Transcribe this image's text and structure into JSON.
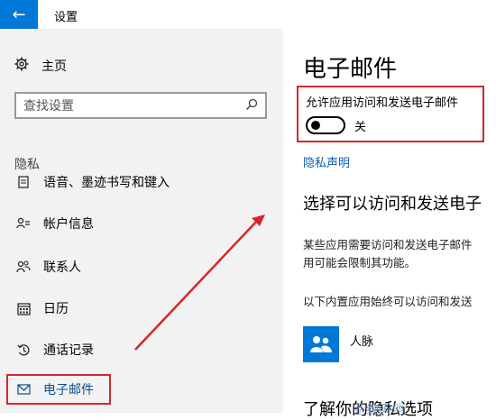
{
  "titlebar": {
    "title": "设置",
    "back_icon": "back-arrow-icon"
  },
  "sidebar": {
    "home_label": "主页",
    "search_placeholder": "查找设置",
    "section_header": "隐私",
    "items": [
      {
        "label": "语音、墨迹书写和键入",
        "icon": "pen-icon"
      },
      {
        "label": "帐户信息",
        "icon": "account-info-icon"
      },
      {
        "label": "联系人",
        "icon": "contacts-icon"
      },
      {
        "label": "日历",
        "icon": "calendar-icon"
      },
      {
        "label": "通话记录",
        "icon": "call-history-icon"
      },
      {
        "label": "电子邮件",
        "icon": "mail-icon",
        "selected": true
      }
    ]
  },
  "main": {
    "title": "电子邮件",
    "toggle": {
      "label": "允许应用访问和发送电子邮件",
      "state_text": "关",
      "on": false
    },
    "privacy_link": "隐私声明",
    "section_heading": "选择可以访问和发送电子",
    "description_line1": "某些应用需要访问和发送电子邮件",
    "description_line2": "用可能会限制其功能。",
    "builtin_note": "以下内置应用始终可以访问和发送",
    "apps": [
      {
        "name": "人脉",
        "icon": "people-app-icon"
      }
    ],
    "more_heading": "了解你的隐私选项",
    "watermark": "系统天地"
  },
  "colors": {
    "accent": "#0078d7",
    "highlight_border": "#d6262b",
    "link": "#0a5fb3"
  }
}
